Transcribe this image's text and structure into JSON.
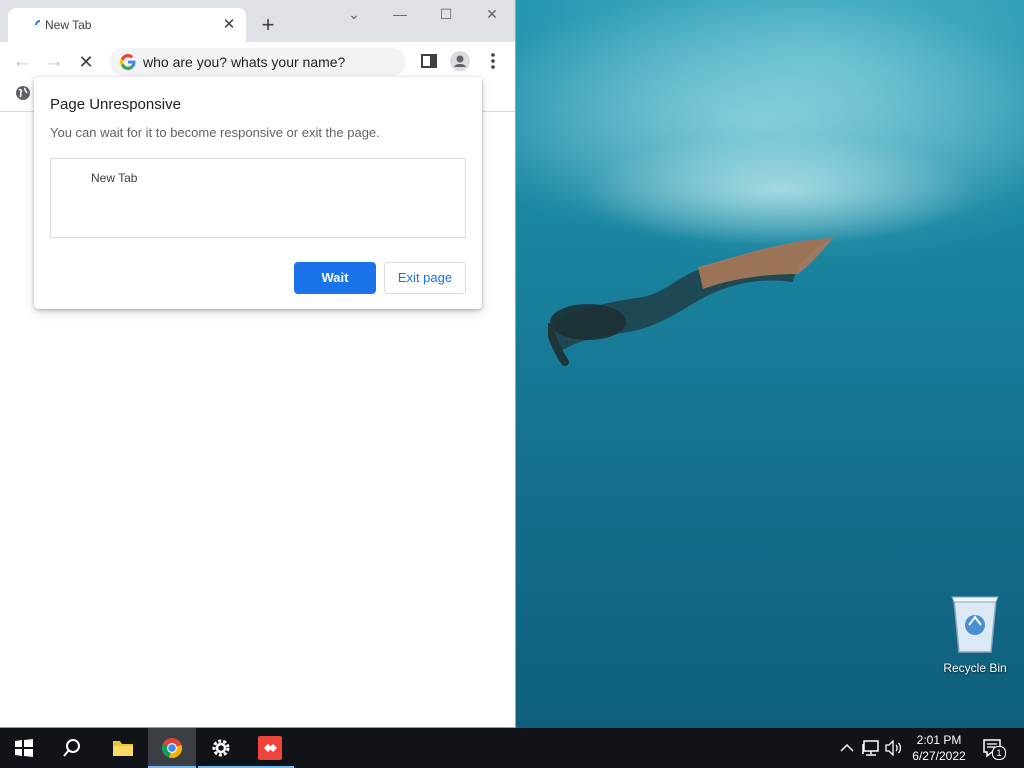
{
  "browser": {
    "tab_title": "New Tab",
    "address_text": "who are you? whats your name?"
  },
  "dialog": {
    "title": "Page Unresponsive",
    "message": "You can wait for it to become responsive or exit the page.",
    "pages": [
      "New Tab"
    ],
    "wait_label": "Wait",
    "exit_label": "Exit page"
  },
  "desktop": {
    "recycle_bin_label": "Recycle Bin"
  },
  "taskbar": {
    "time": "2:01 PM",
    "date": "6/27/2022",
    "notification_count": "1",
    "apps": [
      "windows-start-icon",
      "search-icon",
      "file-explorer-icon",
      "chrome-icon",
      "settings-gear-icon",
      "anydesk-icon"
    ]
  },
  "colors": {
    "accent": "#1a73e8",
    "taskbar": "#101419",
    "tab_strip": "#dee1e6"
  }
}
